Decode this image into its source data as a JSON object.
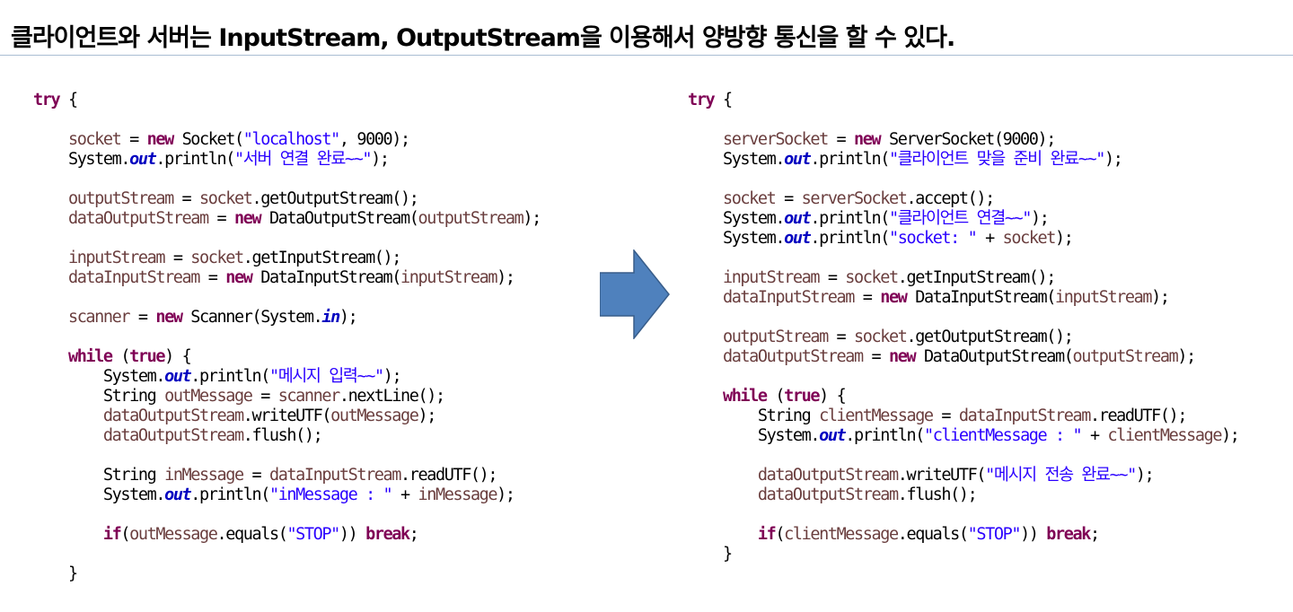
{
  "slide": {
    "title": "클라이언트와 서버는 InputStream, OutputStream을 이용해서 양방향 통신을 할 수 있다."
  },
  "client_code": {
    "lines": [
      [
        {
          "t": "try",
          "c": "kw"
        },
        {
          "t": " {"
        }
      ],
      [],
      [
        {
          "t": "    "
        },
        {
          "t": "socket",
          "c": "var"
        },
        {
          "t": " = "
        },
        {
          "t": "new",
          "c": "kw"
        },
        {
          "t": " Socket("
        },
        {
          "t": "\"localhost\"",
          "c": "str"
        },
        {
          "t": ", 9000);"
        }
      ],
      [
        {
          "t": "    System."
        },
        {
          "t": "out",
          "c": "static"
        },
        {
          "t": ".println("
        },
        {
          "t": "\"서버 연결 완료~~\"",
          "c": "str"
        },
        {
          "t": ");"
        }
      ],
      [],
      [
        {
          "t": "    "
        },
        {
          "t": "outputStream",
          "c": "var"
        },
        {
          "t": " = "
        },
        {
          "t": "socket",
          "c": "var"
        },
        {
          "t": ".getOutputStream();"
        }
      ],
      [
        {
          "t": "    "
        },
        {
          "t": "dataOutputStream",
          "c": "var"
        },
        {
          "t": " = "
        },
        {
          "t": "new",
          "c": "kw"
        },
        {
          "t": " DataOutputStream("
        },
        {
          "t": "outputStream",
          "c": "var"
        },
        {
          "t": ");"
        }
      ],
      [],
      [
        {
          "t": "    "
        },
        {
          "t": "inputStream",
          "c": "var"
        },
        {
          "t": " = "
        },
        {
          "t": "socket",
          "c": "var"
        },
        {
          "t": ".getInputStream();"
        }
      ],
      [
        {
          "t": "    "
        },
        {
          "t": "dataInputStream",
          "c": "var"
        },
        {
          "t": " = "
        },
        {
          "t": "new",
          "c": "kw"
        },
        {
          "t": " DataInputStream("
        },
        {
          "t": "inputStream",
          "c": "var"
        },
        {
          "t": ");"
        }
      ],
      [],
      [
        {
          "t": "    "
        },
        {
          "t": "scanner",
          "c": "var"
        },
        {
          "t": " = "
        },
        {
          "t": "new",
          "c": "kw"
        },
        {
          "t": " Scanner(System."
        },
        {
          "t": "in",
          "c": "static"
        },
        {
          "t": ");"
        }
      ],
      [],
      [
        {
          "t": "    "
        },
        {
          "t": "while",
          "c": "kw"
        },
        {
          "t": " ("
        },
        {
          "t": "true",
          "c": "kw"
        },
        {
          "t": ") {"
        }
      ],
      [
        {
          "t": "        System."
        },
        {
          "t": "out",
          "c": "static"
        },
        {
          "t": ".println("
        },
        {
          "t": "\"메시지 입력~~\"",
          "c": "str"
        },
        {
          "t": ");"
        }
      ],
      [
        {
          "t": "        String "
        },
        {
          "t": "outMessage",
          "c": "var"
        },
        {
          "t": " = "
        },
        {
          "t": "scanner",
          "c": "var"
        },
        {
          "t": ".nextLine();"
        }
      ],
      [
        {
          "t": "        "
        },
        {
          "t": "dataOutputStream",
          "c": "var"
        },
        {
          "t": ".writeUTF("
        },
        {
          "t": "outMessage",
          "c": "var"
        },
        {
          "t": ");"
        }
      ],
      [
        {
          "t": "        "
        },
        {
          "t": "dataOutputStream",
          "c": "var"
        },
        {
          "t": ".flush();"
        }
      ],
      [],
      [
        {
          "t": "        String "
        },
        {
          "t": "inMessage",
          "c": "var"
        },
        {
          "t": " = "
        },
        {
          "t": "dataInputStream",
          "c": "var"
        },
        {
          "t": ".readUTF();"
        }
      ],
      [
        {
          "t": "        System."
        },
        {
          "t": "out",
          "c": "static"
        },
        {
          "t": ".println("
        },
        {
          "t": "\"inMessage : \"",
          "c": "str"
        },
        {
          "t": " + "
        },
        {
          "t": "inMessage",
          "c": "var"
        },
        {
          "t": ");"
        }
      ],
      [],
      [
        {
          "t": "        "
        },
        {
          "t": "if",
          "c": "kw"
        },
        {
          "t": "("
        },
        {
          "t": "outMessage",
          "c": "var"
        },
        {
          "t": ".equals("
        },
        {
          "t": "\"STOP\"",
          "c": "str"
        },
        {
          "t": ")) "
        },
        {
          "t": "break",
          "c": "kw"
        },
        {
          "t": ";"
        }
      ],
      [],
      [
        {
          "t": "    }"
        }
      ]
    ]
  },
  "server_code": {
    "lines": [
      [
        {
          "t": "try",
          "c": "kw"
        },
        {
          "t": " {"
        }
      ],
      [],
      [
        {
          "t": "    "
        },
        {
          "t": "serverSocket",
          "c": "var"
        },
        {
          "t": " = "
        },
        {
          "t": "new",
          "c": "kw"
        },
        {
          "t": " ServerSocket(9000);"
        }
      ],
      [
        {
          "t": "    System."
        },
        {
          "t": "out",
          "c": "static"
        },
        {
          "t": ".println("
        },
        {
          "t": "\"클라이언트 맞을 준비 완료~~\"",
          "c": "str"
        },
        {
          "t": ");"
        }
      ],
      [],
      [
        {
          "t": "    "
        },
        {
          "t": "socket",
          "c": "var"
        },
        {
          "t": " = "
        },
        {
          "t": "serverSocket",
          "c": "var"
        },
        {
          "t": ".accept();"
        }
      ],
      [
        {
          "t": "    System."
        },
        {
          "t": "out",
          "c": "static"
        },
        {
          "t": ".println("
        },
        {
          "t": "\"클라이언트 연결~~\"",
          "c": "str"
        },
        {
          "t": ");"
        }
      ],
      [
        {
          "t": "    System."
        },
        {
          "t": "out",
          "c": "static"
        },
        {
          "t": ".println("
        },
        {
          "t": "\"socket: \"",
          "c": "str"
        },
        {
          "t": " + "
        },
        {
          "t": "socket",
          "c": "var"
        },
        {
          "t": ");"
        }
      ],
      [],
      [
        {
          "t": "    "
        },
        {
          "t": "inputStream",
          "c": "var"
        },
        {
          "t": " = "
        },
        {
          "t": "socket",
          "c": "var"
        },
        {
          "t": ".getInputStream();"
        }
      ],
      [
        {
          "t": "    "
        },
        {
          "t": "dataInputStream",
          "c": "var"
        },
        {
          "t": " = "
        },
        {
          "t": "new",
          "c": "kw"
        },
        {
          "t": " DataInputStream("
        },
        {
          "t": "inputStream",
          "c": "var"
        },
        {
          "t": ");"
        }
      ],
      [],
      [
        {
          "t": "    "
        },
        {
          "t": "outputStream",
          "c": "var"
        },
        {
          "t": " = "
        },
        {
          "t": "socket",
          "c": "var"
        },
        {
          "t": ".getOutputStream();"
        }
      ],
      [
        {
          "t": "    "
        },
        {
          "t": "dataOutputStream",
          "c": "var"
        },
        {
          "t": " = "
        },
        {
          "t": "new",
          "c": "kw"
        },
        {
          "t": " DataOutputStream("
        },
        {
          "t": "outputStream",
          "c": "var"
        },
        {
          "t": ");"
        }
      ],
      [],
      [
        {
          "t": "    "
        },
        {
          "t": "while",
          "c": "kw"
        },
        {
          "t": " ("
        },
        {
          "t": "true",
          "c": "kw"
        },
        {
          "t": ") {"
        }
      ],
      [
        {
          "t": "        String "
        },
        {
          "t": "clientMessage",
          "c": "var"
        },
        {
          "t": " = "
        },
        {
          "t": "dataInputStream",
          "c": "var"
        },
        {
          "t": ".readUTF();"
        }
      ],
      [
        {
          "t": "        System."
        },
        {
          "t": "out",
          "c": "static"
        },
        {
          "t": ".println("
        },
        {
          "t": "\"clientMessage : \"",
          "c": "str"
        },
        {
          "t": " + "
        },
        {
          "t": "clientMessage",
          "c": "var"
        },
        {
          "t": ");"
        }
      ],
      [],
      [
        {
          "t": "        "
        },
        {
          "t": "dataOutputStream",
          "c": "var"
        },
        {
          "t": ".writeUTF("
        },
        {
          "t": "\"메시지 전송 완료~~\"",
          "c": "str"
        },
        {
          "t": ");"
        }
      ],
      [
        {
          "t": "        "
        },
        {
          "t": "dataOutputStream",
          "c": "var"
        },
        {
          "t": ".flush();"
        }
      ],
      [],
      [
        {
          "t": "        "
        },
        {
          "t": "if",
          "c": "kw"
        },
        {
          "t": "("
        },
        {
          "t": "clientMessage",
          "c": "var"
        },
        {
          "t": ".equals("
        },
        {
          "t": "\"STOP\"",
          "c": "str"
        },
        {
          "t": ")) "
        },
        {
          "t": "break",
          "c": "kw"
        },
        {
          "t": ";"
        }
      ],
      [
        {
          "t": "    }"
        }
      ]
    ]
  },
  "colors": {
    "keyword": "#7f0055",
    "variable": "#6a3e3e",
    "string": "#2a00ff",
    "static_field": "#0000c0",
    "arrow_fill": "#4f81bd",
    "arrow_stroke": "#385d8a",
    "title_rule": "#a9bdd3"
  },
  "arrow": {
    "icon": "right-arrow-icon",
    "direction": "right"
  }
}
